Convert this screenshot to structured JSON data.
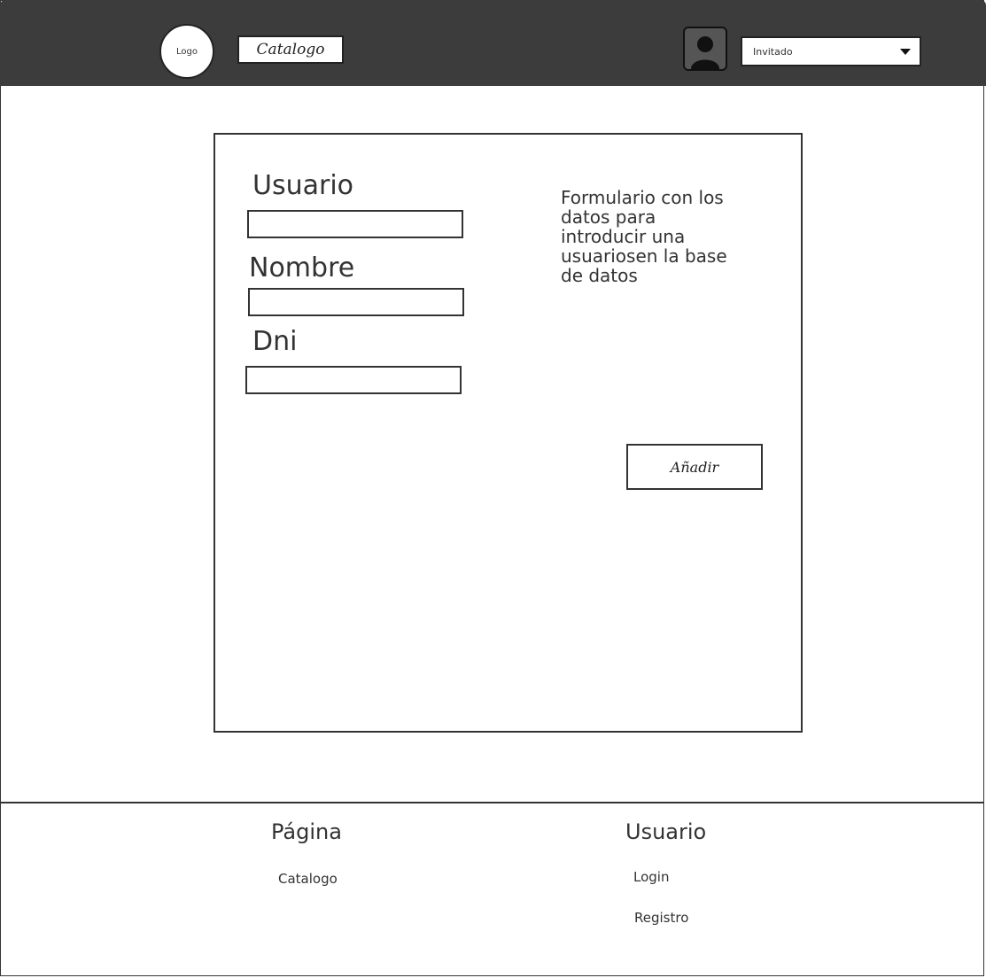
{
  "header": {
    "logo_label": "Logo",
    "catalog_button": "Catalogo",
    "avatar_icon": "user-avatar-icon",
    "user_select_value": "Invitado",
    "user_select_icon": "caret-down-icon",
    "background_color": "#3c3c3c"
  },
  "form": {
    "fields": [
      {
        "label": "Usuario",
        "value": ""
      },
      {
        "label": "Nombre",
        "value": ""
      },
      {
        "label": "Dni",
        "value": ""
      }
    ],
    "description": "Formulario con los datos para introducir una usuariosen la base de datos",
    "submit_label": "Añadir"
  },
  "footer": {
    "page_section": {
      "heading": "Página",
      "links": [
        "Catalogo"
      ]
    },
    "user_section": {
      "heading": "Usuario",
      "links": [
        "Login",
        "Registro"
      ]
    }
  }
}
